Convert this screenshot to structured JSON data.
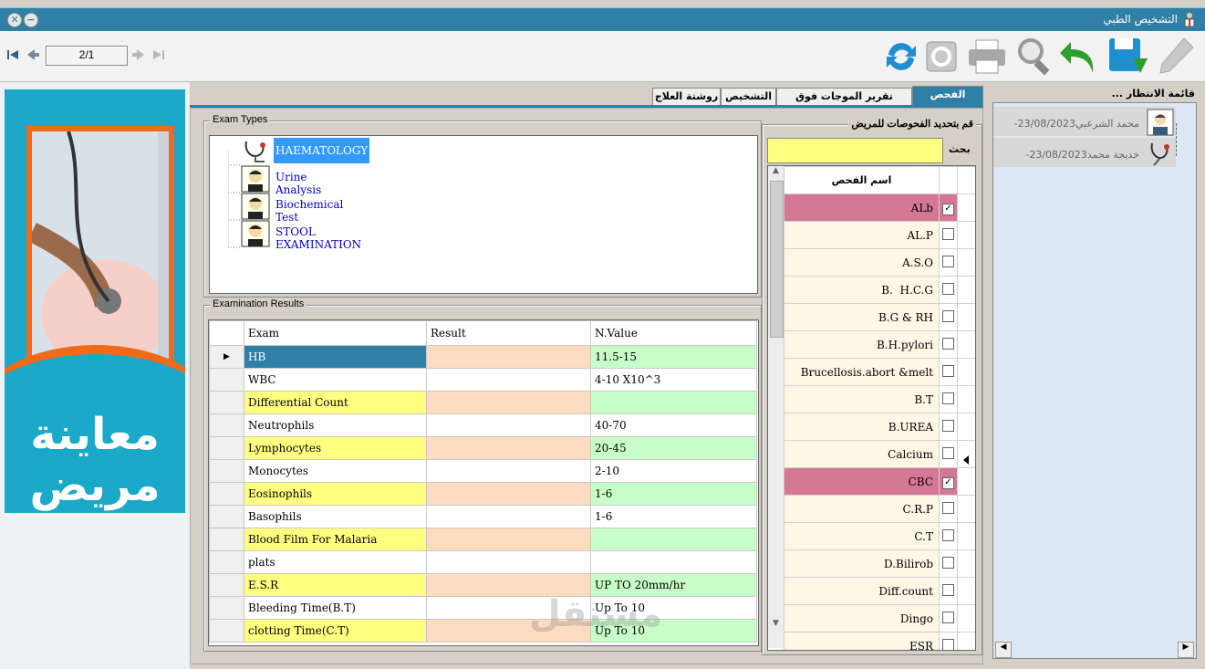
{
  "window": {
    "title": "التشخيص الطبي"
  },
  "pager": {
    "value": "2/1"
  },
  "tabs": [
    {
      "label": "الفحص الطبي",
      "active": true
    },
    {
      "label": "تقرير الموجات فوق الصوتية",
      "active": false
    },
    {
      "label": "التشخيص",
      "active": false
    },
    {
      "label": "روشتة العلاج",
      "active": false
    }
  ],
  "poster": {
    "text": "معاينة مريض"
  },
  "exam_types": {
    "legend": "Exam Types",
    "items": [
      "HAEMATOLOGY",
      "Urine Analysis",
      "Biochemical Test",
      "STOOL EXAMINATION"
    ]
  },
  "results": {
    "legend": "Examination Results",
    "columns": [
      "Exam",
      "Result",
      "N.Value"
    ],
    "rows": [
      {
        "exam": "HB",
        "result": "",
        "nvalue": "11.5-15"
      },
      {
        "exam": "WBC",
        "result": "",
        "nvalue": "4-10 X10^3"
      },
      {
        "exam": "Differential Count",
        "result": "",
        "nvalue": ""
      },
      {
        "exam": "Neutrophils",
        "result": "",
        "nvalue": "40-70"
      },
      {
        "exam": "Lymphocytes",
        "result": "",
        "nvalue": "20-45"
      },
      {
        "exam": "Monocytes",
        "result": "",
        "nvalue": "2-10"
      },
      {
        "exam": "Eosinophils",
        "result": "",
        "nvalue": "1-6"
      },
      {
        "exam": "Basophils",
        "result": "",
        "nvalue": "1-6"
      },
      {
        "exam": "Blood Film For Malaria",
        "result": "",
        "nvalue": ""
      },
      {
        "exam": "plats",
        "result": "",
        "nvalue": ""
      },
      {
        "exam": "E.S.R",
        "result": "",
        "nvalue": "UP TO 20mm/hr"
      },
      {
        "exam": "Bleeding Time(B.T)",
        "result": "",
        "nvalue": "Up To 10"
      },
      {
        "exam": "clotting Time(C.T)",
        "result": "",
        "nvalue": "Up To 10"
      }
    ]
  },
  "select_exams": {
    "legend": "قم بتحديد الفحوصات للمريض",
    "search_label": "بحث",
    "search_value": "",
    "column": "اسم الفحص",
    "items": [
      {
        "name": "ALb",
        "checked": true
      },
      {
        "name": "AL.P",
        "checked": false
      },
      {
        "name": "A.S.O",
        "checked": false
      },
      {
        "name": "B.  H.C.G",
        "checked": false
      },
      {
        "name": "B.G & RH",
        "checked": false
      },
      {
        "name": "B.H.pylori",
        "checked": false
      },
      {
        "name": "Brucellosis.abort &melt",
        "checked": false
      },
      {
        "name": "B.T",
        "checked": false
      },
      {
        "name": "B.UREA",
        "checked": false
      },
      {
        "name": "Calcium",
        "checked": false
      },
      {
        "name": "CBC",
        "checked": true
      },
      {
        "name": "C.R.P",
        "checked": false
      },
      {
        "name": "C.T",
        "checked": false
      },
      {
        "name": "D.Bilirob",
        "checked": false
      },
      {
        "name": "Diff.count",
        "checked": false
      },
      {
        "name": "Dingo",
        "checked": false
      },
      {
        "name": "ESR",
        "checked": false
      }
    ]
  },
  "waiting_list": {
    "title": "قائمة الانتظار ...",
    "items": [
      {
        "name": "محمد الشرعبي",
        "date": "23/08/2023-",
        "icon": "male-avatar-icon"
      },
      {
        "name": "خديجة محمد",
        "date": "23/08/2023-",
        "icon": "stethoscope-icon"
      }
    ]
  },
  "watermark": "مستقل",
  "colors": {
    "titlebar": "#2f7fa6",
    "highlight_row": "#ffff80",
    "result_cell": "#ffdcc0",
    "nvalue_cell": "#c8ffc8",
    "checked_row": "#d47896"
  }
}
